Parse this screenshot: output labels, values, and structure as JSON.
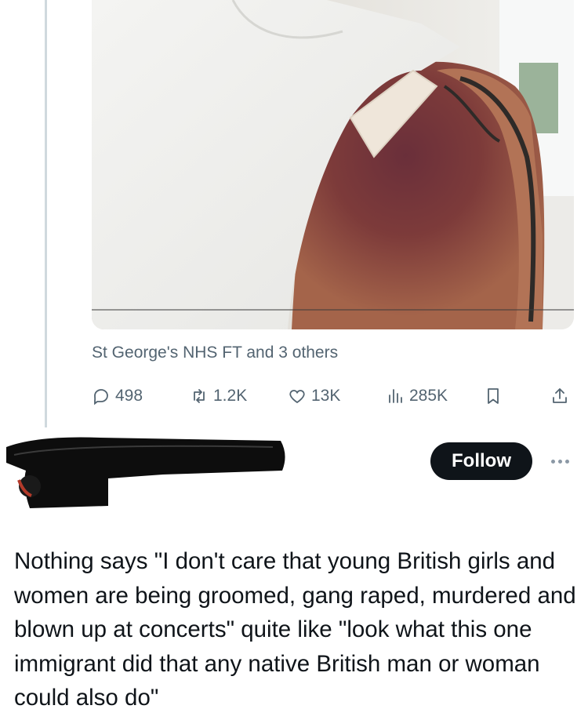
{
  "tweet": {
    "tagged_text": "St George's NHS FT and 3 others",
    "actions": {
      "replies": "498",
      "reposts": "1.2K",
      "likes": "13K",
      "views": "285K"
    }
  },
  "reply": {
    "follow_label": "Follow",
    "body": "Nothing says \"I don't care that young British girls and women are being groomed, gang raped, murdered and blown up at concerts\" quite like \"look what this one immigrant did that any native British man or woman could also do\""
  },
  "icons": [
    "reply-icon",
    "repost-icon",
    "like-icon",
    "views-icon",
    "bookmark-icon",
    "share-icon",
    "more-icon"
  ]
}
